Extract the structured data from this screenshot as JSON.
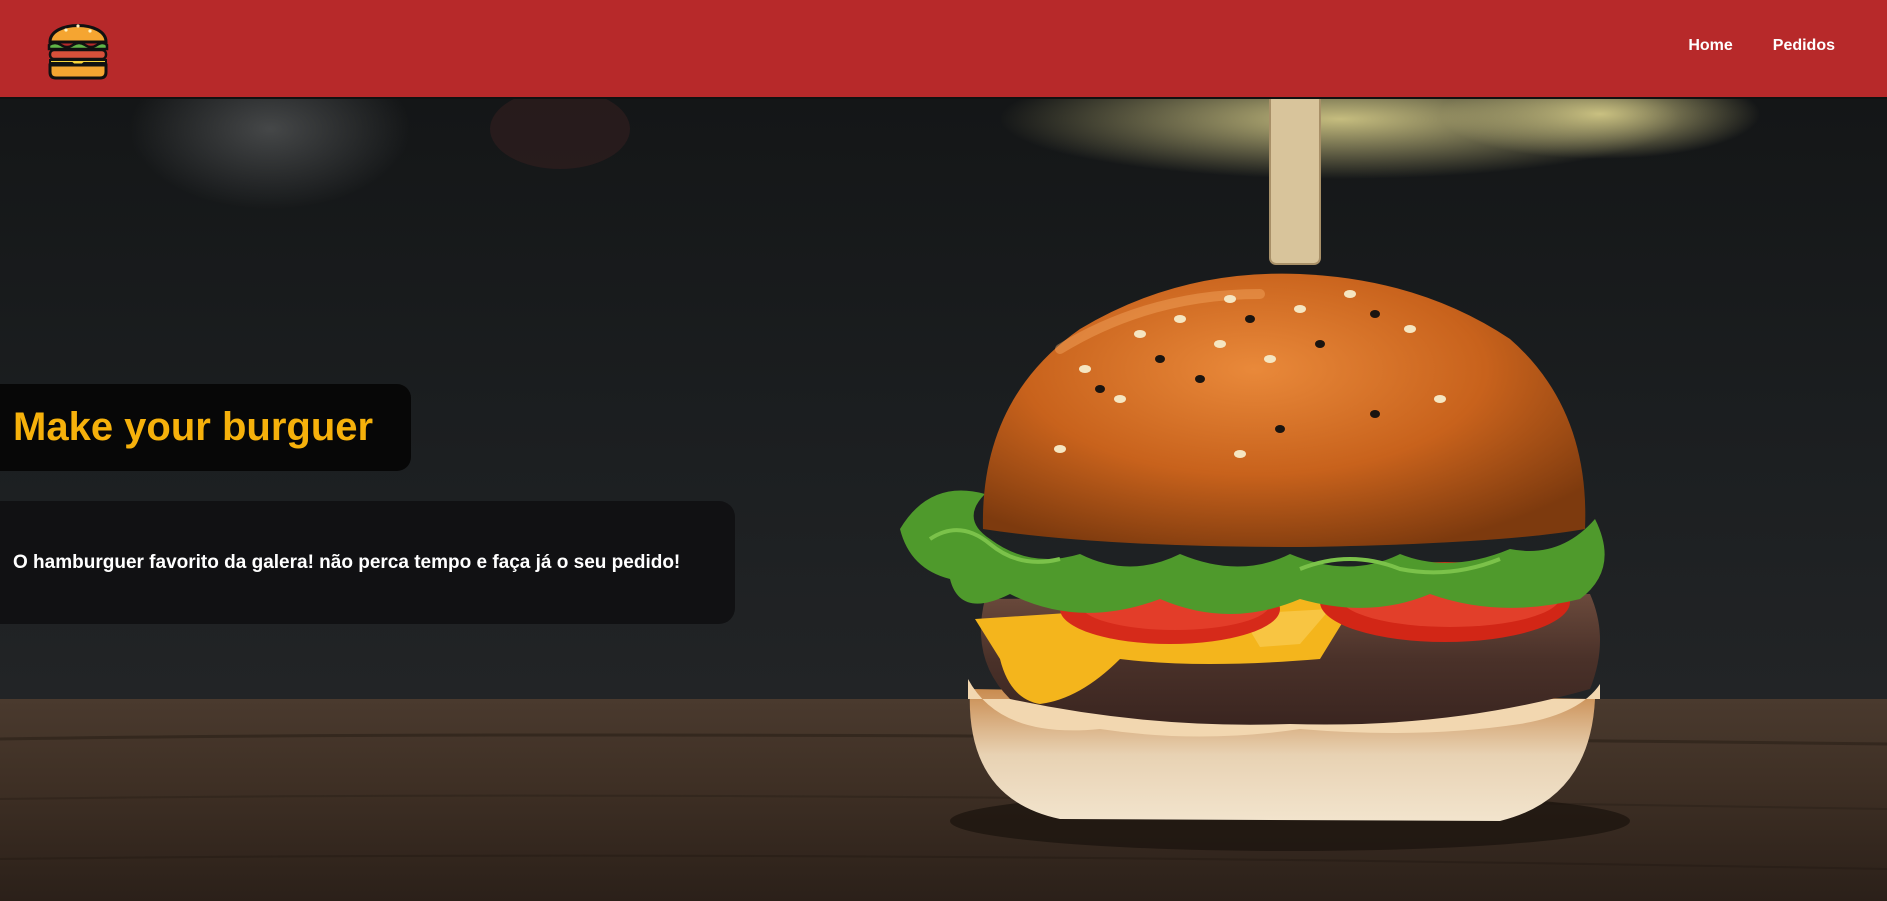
{
  "header": {
    "logo_icon": "burger-logo-icon",
    "nav": [
      {
        "label": "Home"
      },
      {
        "label": "Pedidos"
      }
    ],
    "background_color": "#b7292a"
  },
  "hero": {
    "title": "Make your burguer",
    "subtitle": "O hamburguer favorito da galera! não perca tempo e faça já o seu pedido!",
    "title_color": "#f6b10b",
    "image_icon": "burger-photo"
  }
}
